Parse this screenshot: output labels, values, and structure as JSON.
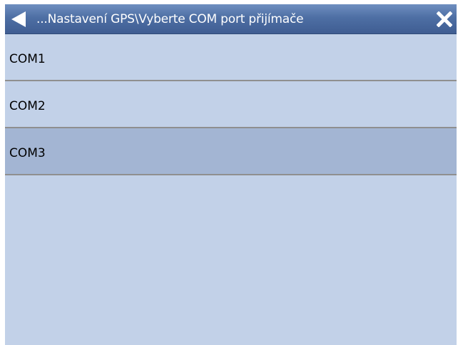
{
  "header": {
    "title": "...Nastavení GPS\\Vyberte COM port přijímače",
    "back_icon": "back-arrow-icon",
    "close_icon": "close-x-icon"
  },
  "ports": {
    "items": [
      {
        "label": "COM1",
        "selected": false
      },
      {
        "label": "COM2",
        "selected": false
      },
      {
        "label": "COM3",
        "selected": true
      }
    ]
  },
  "colors": {
    "background": "#c2d1e8",
    "selected_row": "#a3b5d3",
    "titlebar": "#4e6fa4",
    "separator": "#8f8f8f"
  }
}
